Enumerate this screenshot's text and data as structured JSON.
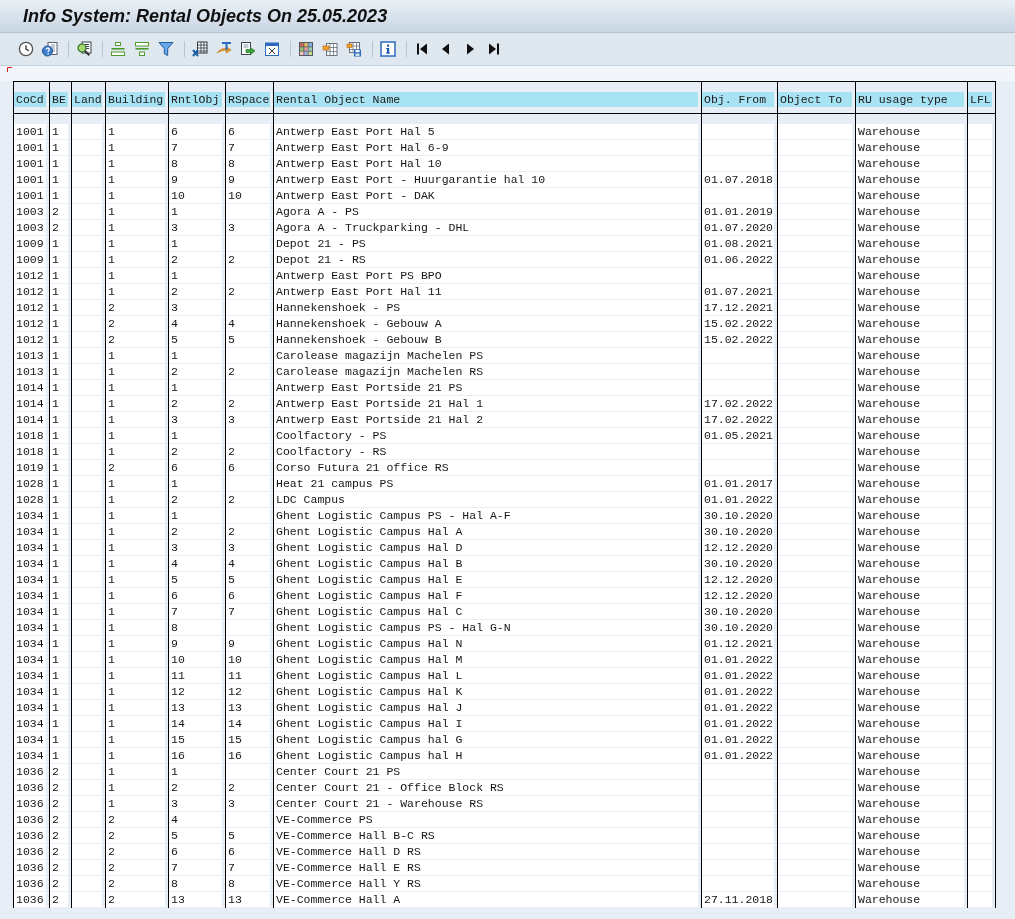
{
  "window": {
    "title": "Info System: Rental Objects On 25.05.2023"
  },
  "table": {
    "columns": [
      "CoCd",
      "BE",
      "Land",
      "Building",
      "RntlObj",
      "RSpace",
      "Rental Object Name",
      "Obj. From",
      "Object To",
      "RU usage type",
      "LFL"
    ],
    "rows": [
      {
        "company_code": "1001",
        "business_entity": "1",
        "building": "1",
        "rental_object": "6",
        "rental_space": "6",
        "name": "Antwerp East Port Hal 5",
        "usage_type": "Warehouse"
      },
      {
        "company_code": "1001",
        "business_entity": "1",
        "building": "1",
        "rental_object": "7",
        "rental_space": "7",
        "name": "Antwerp East Port Hal 6-9",
        "usage_type": "Warehouse"
      },
      {
        "company_code": "1001",
        "business_entity": "1",
        "building": "1",
        "rental_object": "8",
        "rental_space": "8",
        "name": "Antwerp East Port Hal 10",
        "usage_type": "Warehouse"
      },
      {
        "company_code": "1001",
        "business_entity": "1",
        "building": "1",
        "rental_object": "9",
        "rental_space": "9",
        "name": "Antwerp East Port - Huurgarantie hal 10",
        "object_from": "01.07.2018",
        "usage_type": "Warehouse"
      },
      {
        "company_code": "1001",
        "business_entity": "1",
        "building": "1",
        "rental_object": "10",
        "rental_space": "10",
        "name": "Antwerp East Port - DAK",
        "usage_type": "Warehouse"
      },
      {
        "company_code": "1003",
        "business_entity": "2",
        "building": "1",
        "rental_object": "1",
        "name": "Agora A - PS",
        "object_from": "01.01.2019",
        "usage_type": "Warehouse"
      },
      {
        "company_code": "1003",
        "business_entity": "2",
        "building": "1",
        "rental_object": "3",
        "rental_space": "3",
        "name": "Agora A - Truckparking - DHL",
        "object_from": "01.07.2020",
        "usage_type": "Warehouse"
      },
      {
        "company_code": "1009",
        "business_entity": "1",
        "building": "1",
        "rental_object": "1",
        "name": "Depot 21 - PS",
        "object_from": "01.08.2021",
        "usage_type": "Warehouse"
      },
      {
        "company_code": "1009",
        "business_entity": "1",
        "building": "1",
        "rental_object": "2",
        "rental_space": "2",
        "name": "Depot 21 - RS",
        "object_from": "01.06.2022",
        "usage_type": "Warehouse"
      },
      {
        "company_code": "1012",
        "business_entity": "1",
        "building": "1",
        "rental_object": "1",
        "name": "Antwerp East Port PS BPO",
        "usage_type": "Warehouse"
      },
      {
        "company_code": "1012",
        "business_entity": "1",
        "building": "1",
        "rental_object": "2",
        "rental_space": "2",
        "name": "Antwerp East Port Hal 11",
        "object_from": "01.07.2021",
        "usage_type": "Warehouse"
      },
      {
        "company_code": "1012",
        "business_entity": "1",
        "building": "2",
        "rental_object": "3",
        "name": "Hannekenshoek - PS",
        "object_from": "17.12.2021",
        "usage_type": "Warehouse"
      },
      {
        "company_code": "1012",
        "business_entity": "1",
        "building": "2",
        "rental_object": "4",
        "rental_space": "4",
        "name": "Hannekenshoek - Gebouw A",
        "object_from": "15.02.2022",
        "usage_type": "Warehouse"
      },
      {
        "company_code": "1012",
        "business_entity": "1",
        "building": "2",
        "rental_object": "5",
        "rental_space": "5",
        "name": "Hannekenshoek - Gebouw B",
        "object_from": "15.02.2022",
        "usage_type": "Warehouse"
      },
      {
        "company_code": "1013",
        "business_entity": "1",
        "building": "1",
        "rental_object": "1",
        "name": "Carolease magazijn Machelen PS",
        "usage_type": "Warehouse"
      },
      {
        "company_code": "1013",
        "business_entity": "1",
        "building": "1",
        "rental_object": "2",
        "rental_space": "2",
        "name": "Carolease magazijn Machelen RS",
        "usage_type": "Warehouse"
      },
      {
        "company_code": "1014",
        "business_entity": "1",
        "building": "1",
        "rental_object": "1",
        "name": "Antwerp East Portside 21 PS",
        "usage_type": "Warehouse"
      },
      {
        "company_code": "1014",
        "business_entity": "1",
        "building": "1",
        "rental_object": "2",
        "rental_space": "2",
        "name": "Antwerp East Portside 21 Hal 1",
        "object_from": "17.02.2022",
        "usage_type": "Warehouse"
      },
      {
        "company_code": "1014",
        "business_entity": "1",
        "building": "1",
        "rental_object": "3",
        "rental_space": "3",
        "name": "Antwerp East Portside 21 Hal 2",
        "object_from": "17.02.2022",
        "usage_type": "Warehouse"
      },
      {
        "company_code": "1018",
        "business_entity": "1",
        "building": "1",
        "rental_object": "1",
        "name": "Coolfactory - PS",
        "object_from": "01.05.2021",
        "usage_type": "Warehouse"
      },
      {
        "company_code": "1018",
        "business_entity": "1",
        "building": "1",
        "rental_object": "2",
        "rental_space": "2",
        "name": "Coolfactory - RS",
        "usage_type": "Warehouse"
      },
      {
        "company_code": "1019",
        "business_entity": "1",
        "building": "2",
        "rental_object": "6",
        "rental_space": "6",
        "name": "Corso Futura 21 office RS",
        "usage_type": "Warehouse"
      },
      {
        "company_code": "1028",
        "business_entity": "1",
        "building": "1",
        "rental_object": "1",
        "name": "Heat 21 campus PS",
        "object_from": "01.01.2017",
        "usage_type": "Warehouse"
      },
      {
        "company_code": "1028",
        "business_entity": "1",
        "building": "1",
        "rental_object": "2",
        "rental_space": "2",
        "name": "LDC Campus",
        "object_from": "01.01.2022",
        "usage_type": "Warehouse"
      },
      {
        "company_code": "1034",
        "business_entity": "1",
        "building": "1",
        "rental_object": "1",
        "name": "Ghent Logistic Campus PS - Hal A-F",
        "object_from": "30.10.2020",
        "usage_type": "Warehouse"
      },
      {
        "company_code": "1034",
        "business_entity": "1",
        "building": "1",
        "rental_object": "2",
        "rental_space": "2",
        "name": "Ghent Logistic Campus Hal A",
        "object_from": "30.10.2020",
        "usage_type": "Warehouse"
      },
      {
        "company_code": "1034",
        "business_entity": "1",
        "building": "1",
        "rental_object": "3",
        "rental_space": "3",
        "name": "Ghent Logistic Campus Hal D",
        "object_from": "12.12.2020",
        "usage_type": "Warehouse"
      },
      {
        "company_code": "1034",
        "business_entity": "1",
        "building": "1",
        "rental_object": "4",
        "rental_space": "4",
        "name": "Ghent Logistic Campus Hal B",
        "object_from": "30.10.2020",
        "usage_type": "Warehouse"
      },
      {
        "company_code": "1034",
        "business_entity": "1",
        "building": "1",
        "rental_object": "5",
        "rental_space": "5",
        "name": "Ghent Logistic Campus Hal E",
        "object_from": "12.12.2020",
        "usage_type": "Warehouse"
      },
      {
        "company_code": "1034",
        "business_entity": "1",
        "building": "1",
        "rental_object": "6",
        "rental_space": "6",
        "name": "Ghent Logistic Campus Hal F",
        "object_from": "12.12.2020",
        "usage_type": "Warehouse"
      },
      {
        "company_code": "1034",
        "business_entity": "1",
        "building": "1",
        "rental_object": "7",
        "rental_space": "7",
        "name": "Ghent Logistic Campus Hal C",
        "object_from": "30.10.2020",
        "usage_type": "Warehouse"
      },
      {
        "company_code": "1034",
        "business_entity": "1",
        "building": "1",
        "rental_object": "8",
        "name": "Ghent Logistic Campus PS - Hal G-N",
        "object_from": "30.10.2020",
        "usage_type": "Warehouse"
      },
      {
        "company_code": "1034",
        "business_entity": "1",
        "building": "1",
        "rental_object": "9",
        "rental_space": "9",
        "name": "Ghent Logistic Campus Hal N",
        "object_from": "01.12.2021",
        "usage_type": "Warehouse"
      },
      {
        "company_code": "1034",
        "business_entity": "1",
        "building": "1",
        "rental_object": "10",
        "rental_space": "10",
        "name": "Ghent Logistic Campus Hal M",
        "object_from": "01.01.2022",
        "usage_type": "Warehouse"
      },
      {
        "company_code": "1034",
        "business_entity": "1",
        "building": "1",
        "rental_object": "11",
        "rental_space": "11",
        "name": "Ghent Logistic Campus Hal L",
        "object_from": "01.01.2022",
        "usage_type": "Warehouse"
      },
      {
        "company_code": "1034",
        "business_entity": "1",
        "building": "1",
        "rental_object": "12",
        "rental_space": "12",
        "name": "Ghent Logistic Campus Hal K",
        "object_from": "01.01.2022",
        "usage_type": "Warehouse"
      },
      {
        "company_code": "1034",
        "business_entity": "1",
        "building": "1",
        "rental_object": "13",
        "rental_space": "13",
        "name": "Ghent Logistic Campus Hal J",
        "object_from": "01.01.2022",
        "usage_type": "Warehouse"
      },
      {
        "company_code": "1034",
        "business_entity": "1",
        "building": "1",
        "rental_object": "14",
        "rental_space": "14",
        "name": "Ghent Logistic Campus Hal I",
        "object_from": "01.01.2022",
        "usage_type": "Warehouse"
      },
      {
        "company_code": "1034",
        "business_entity": "1",
        "building": "1",
        "rental_object": "15",
        "rental_space": "15",
        "name": "Ghent Logistic Campus hal G",
        "object_from": "01.01.2022",
        "usage_type": "Warehouse"
      },
      {
        "company_code": "1034",
        "business_entity": "1",
        "building": "1",
        "rental_object": "16",
        "rental_space": "16",
        "name": "Ghent Logistic Campus hal H",
        "object_from": "01.01.2022",
        "usage_type": "Warehouse"
      },
      {
        "company_code": "1036",
        "business_entity": "2",
        "building": "1",
        "rental_object": "1",
        "name": "Center Court 21 PS",
        "usage_type": "Warehouse"
      },
      {
        "company_code": "1036",
        "business_entity": "2",
        "building": "1",
        "rental_object": "2",
        "rental_space": "2",
        "name": "Center Court 21 - Office Block RS",
        "usage_type": "Warehouse"
      },
      {
        "company_code": "1036",
        "business_entity": "2",
        "building": "1",
        "rental_object": "3",
        "rental_space": "3",
        "name": "Center Court 21 - Warehouse RS",
        "usage_type": "Warehouse"
      },
      {
        "company_code": "1036",
        "business_entity": "2",
        "building": "2",
        "rental_object": "4",
        "name": "VE-Commerce PS",
        "usage_type": "Warehouse"
      },
      {
        "company_code": "1036",
        "business_entity": "2",
        "building": "2",
        "rental_object": "5",
        "rental_space": "5",
        "name": "VE-Commerce Hall B-C RS",
        "usage_type": "Warehouse"
      },
      {
        "company_code": "1036",
        "business_entity": "2",
        "building": "2",
        "rental_object": "6",
        "rental_space": "6",
        "name": "VE-Commerce Hall D RS",
        "usage_type": "Warehouse"
      },
      {
        "company_code": "1036",
        "business_entity": "2",
        "building": "2",
        "rental_object": "7",
        "rental_space": "7",
        "name": "VE-Commerce Hall E RS",
        "usage_type": "Warehouse"
      },
      {
        "company_code": "1036",
        "business_entity": "2",
        "building": "2",
        "rental_object": "8",
        "rental_space": "8",
        "name": "VE-Commerce Hall Y RS",
        "usage_type": "Warehouse"
      },
      {
        "company_code": "1036",
        "business_entity": "2",
        "building": "2",
        "rental_object": "13",
        "rental_space": "13",
        "name": "VE-Commerce Hall A",
        "object_from": "27.11.2018",
        "usage_type": "Warehouse"
      }
    ]
  }
}
